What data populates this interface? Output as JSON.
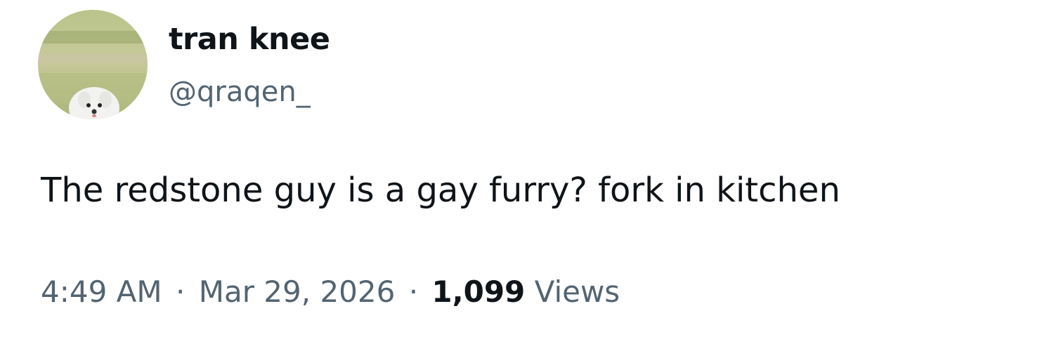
{
  "author": {
    "display_name": "tran knee",
    "handle": "@qraqen_",
    "avatar_icon": "dog-avatar-icon"
  },
  "tweet": {
    "text": "The redstone guy is a gay furry? fork in kitchen"
  },
  "meta": {
    "time": "4:49 AM",
    "separator": "·",
    "date": "Mar 29, 2026",
    "views_count": "1,099",
    "views_label": "Views"
  },
  "colors": {
    "primary_text": "#0f1419",
    "secondary_text": "#536471",
    "background": "#ffffff"
  }
}
